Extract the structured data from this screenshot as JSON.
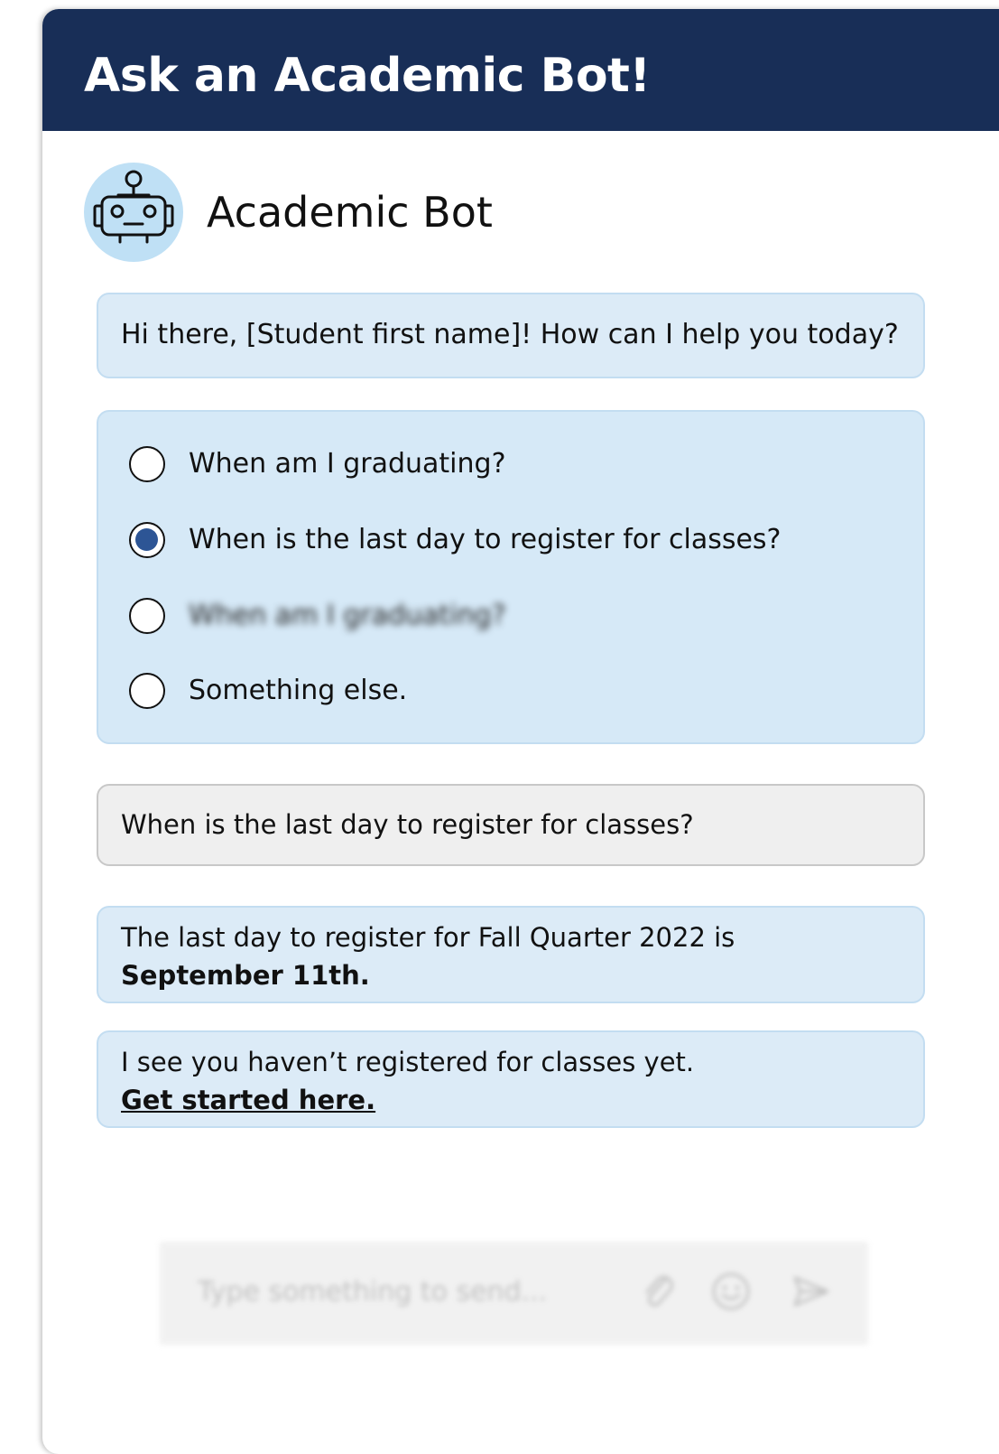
{
  "header": {
    "title": "Ask an Academic Bot!"
  },
  "bot": {
    "name": "Academic Bot",
    "avatar_icon": "robot-icon",
    "avatar_color": "#bfe0f5"
  },
  "messages": {
    "greeting": "Hi there, [Student first name]! How can I help you today?",
    "options": [
      {
        "label": "When am I graduating?",
        "selected": false
      },
      {
        "label": "When is the last day to register for classes?",
        "selected": true
      },
      {
        "label": "When am I graduating?",
        "selected": false,
        "blurred": true
      },
      {
        "label": "Something else.",
        "selected": false
      }
    ],
    "user_reply": "When is the last day to register for classes?",
    "answer_text": "The last day to register for Fall Quarter 2022 is",
    "answer_date": "September 11th.",
    "reminder_text": "I see you haven’t registered for classes yet.",
    "reminder_link": "Get started here."
  },
  "composer": {
    "placeholder": "Type something to send...",
    "icons": [
      "paperclip-icon",
      "emoji-icon",
      "send-icon"
    ]
  },
  "colors": {
    "header_bg": "#182e57",
    "bot_bubble": "#dcebf7",
    "user_bubble": "#efefef",
    "radio_selected": "#2d5595"
  }
}
